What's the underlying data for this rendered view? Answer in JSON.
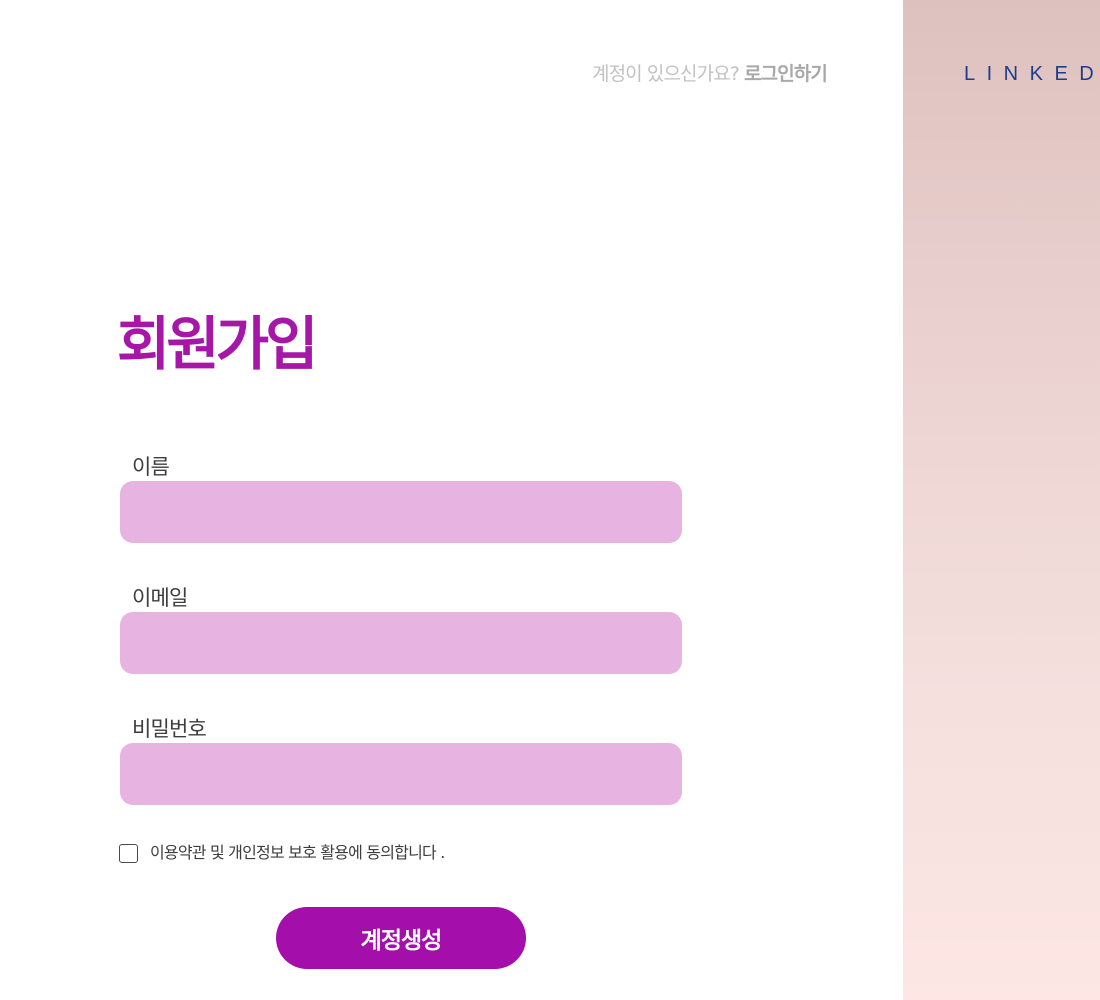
{
  "header": {
    "login_prompt_text": "계정이 있으신가요?",
    "login_link_label": "로그인하기"
  },
  "brand": {
    "logo_text": "LINKED."
  },
  "form": {
    "title": "회원가입",
    "fields": [
      {
        "label": "이름",
        "value": "",
        "placeholder": ""
      },
      {
        "label": "이메일",
        "value": "",
        "placeholder": ""
      },
      {
        "label": "비밀번호",
        "value": "",
        "placeholder": ""
      }
    ],
    "consent": {
      "label": "이용약관 및 개인정보 보호 활용에 동의합니다 .",
      "checked": false
    },
    "submit_label": "계정생성"
  },
  "colors": {
    "accent": "#a617a8",
    "button": "#a40eaa",
    "input_background": "#e7b3e0",
    "logo": "#1e3c8e",
    "panel_top": "#ddc1be",
    "panel_bottom": "#fde6e4"
  }
}
